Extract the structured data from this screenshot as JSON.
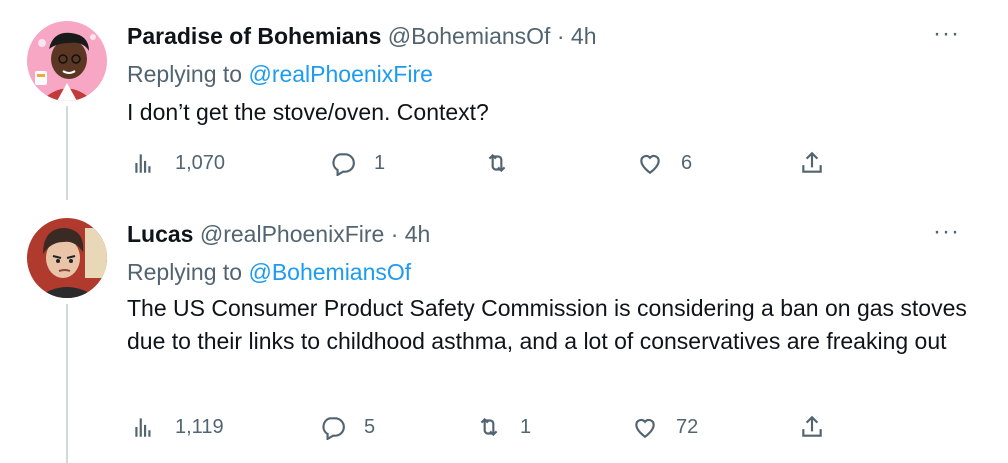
{
  "tweets": [
    {
      "name": "Paradise of Bohemians",
      "handle": "@BohemiansOf",
      "separator": "·",
      "time": "4h",
      "more": "···",
      "replying_prefix": "Replying to",
      "replying_mention": "@realPhoenixFire",
      "text": "I don’t get the stove/oven. Context?",
      "actions": {
        "views": "1,070",
        "replies": "1",
        "retweets": "",
        "likes": "6"
      },
      "avatar_icon": "cartoon-avatar-pink"
    },
    {
      "name": "Lucas",
      "handle": "@realPhoenixFire",
      "separator": "·",
      "time": "4h",
      "more": "···",
      "replying_prefix": "Replying to",
      "replying_mention": "@BohemiansOf",
      "text": "The US Consumer Product Safety Commission is considering a ban on gas stoves due to their links to childhood asthma, and a lot of conservatives are freaking out",
      "actions": {
        "views": "1,119",
        "replies": "5",
        "retweets": "1",
        "likes": "72"
      },
      "avatar_icon": "cartoon-avatar-dark"
    }
  ],
  "colors": {
    "accent": "#1d9bf0",
    "muted": "#536471",
    "text": "#0f1419",
    "thread": "#cfd9de"
  }
}
